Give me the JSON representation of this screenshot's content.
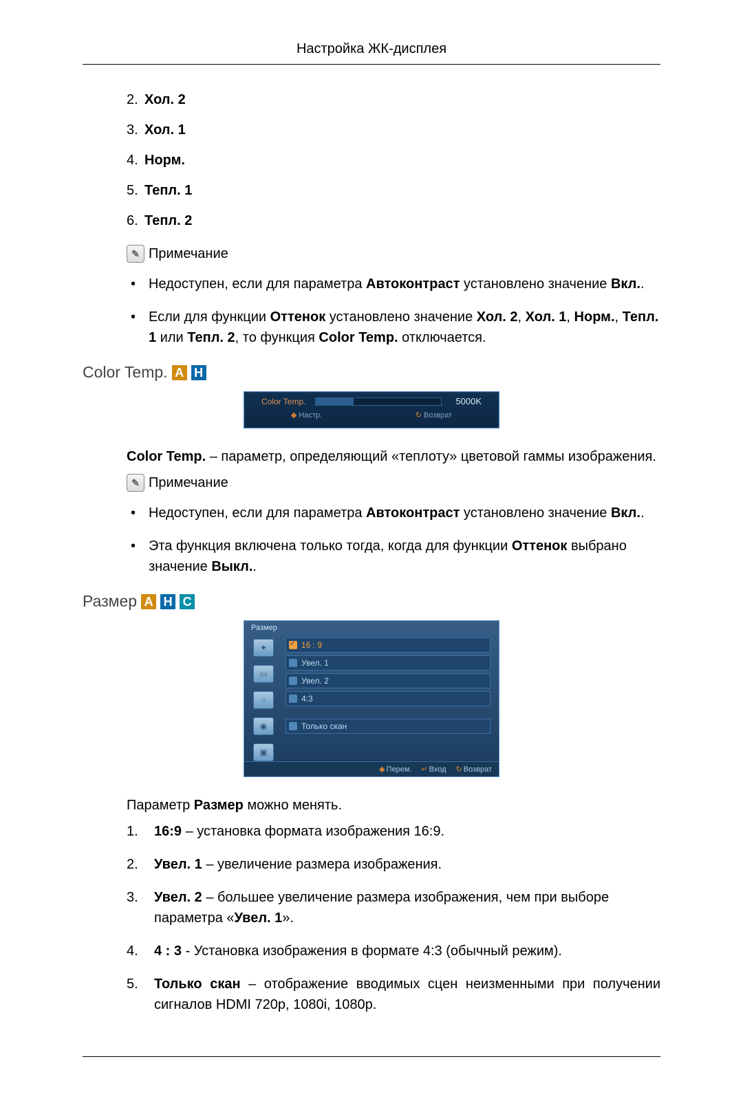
{
  "header": "Настройка ЖК-дисплея",
  "toneList": [
    {
      "num": "2.",
      "label": "Хол. 2"
    },
    {
      "num": "3.",
      "label": "Хол. 1"
    },
    {
      "num": "4.",
      "label": "Норм."
    },
    {
      "num": "5.",
      "label": "Тепл. 1"
    },
    {
      "num": "6.",
      "label": "Тепл. 2"
    }
  ],
  "noteLabel": "Примечание",
  "note1": {
    "b1_pre": "Недоступен, если для параметра ",
    "b1_s1": "Автоконтраст",
    "b1_mid": " установлено значение ",
    "b1_s2": "Вкл.",
    "b1_end": ".",
    "b2_pre": "Если для функции ",
    "b2_s1": "Оттенок",
    "b2_mid1": " установлено значение ",
    "b2_s2": "Хол. 2",
    "b2_c": ", ",
    "b2_s3": "Хол. 1",
    "b2_s4": "Норм.",
    "b2_s5": "Тепл. 1",
    "b2_or": " или ",
    "b2_s6": "Тепл. 2",
    "b2_mid2": ", то функция ",
    "b2_s7": "Color Temp.",
    "b2_end": " отключается."
  },
  "colorTempSection": {
    "title": "Color Temp.",
    "osd": {
      "label": "Color Temp.",
      "value": "5000K",
      "nav": "Настр.",
      "ret": "Возврат"
    },
    "desc_s1": "Color Temp.",
    "desc_rest": " – параметр, определяющий «теплоту» цветовой гаммы изображения.",
    "n1_pre": "Недоступен, если для параметра ",
    "n1_s1": "Автоконтраст",
    "n1_mid": " установлено значение ",
    "n1_s2": "Вкл.",
    "n1_end": ".",
    "n2_pre": "Эта функция включена только тогда, когда для функции ",
    "n2_s1": "Оттенок",
    "n2_mid": " выбрано значение ",
    "n2_s2": "Выкл.",
    "n2_end": "."
  },
  "sizeSection": {
    "title": "Размер",
    "osd": {
      "title": "Размер",
      "opts": [
        "16 : 9",
        "Увел. 1",
        "Увел. 2",
        "4:3",
        "Только скан"
      ],
      "foot": {
        "move": "Перем.",
        "enter": "Вход",
        "ret": "Возврат"
      }
    },
    "intro_pre": "Параметр ",
    "intro_b": "Размер",
    "intro_post": " можно менять.",
    "items": [
      {
        "num": "1.",
        "b": "16:9",
        "rest": " – установка формата изображения 16:9."
      },
      {
        "num": "2.",
        "b": "Увел. 1",
        "rest": " – увеличение размера изображения."
      },
      {
        "num": "3.",
        "b": "Увел. 2",
        "rest": " – большее увеличение размера изображения, чем при выборе параметра «",
        "b2": "Увел. 1",
        "rest2": "»."
      },
      {
        "num": "4.",
        "b": "4 : 3",
        "rest": " - Установка изображения в формате 4:3 (обычный режим)."
      },
      {
        "num": "5.",
        "b": "Только скан",
        "rest": " – отображение вводимых сцен неизменными при получении сигналов HDMI 720p, 1080i, 1080p."
      }
    ]
  }
}
